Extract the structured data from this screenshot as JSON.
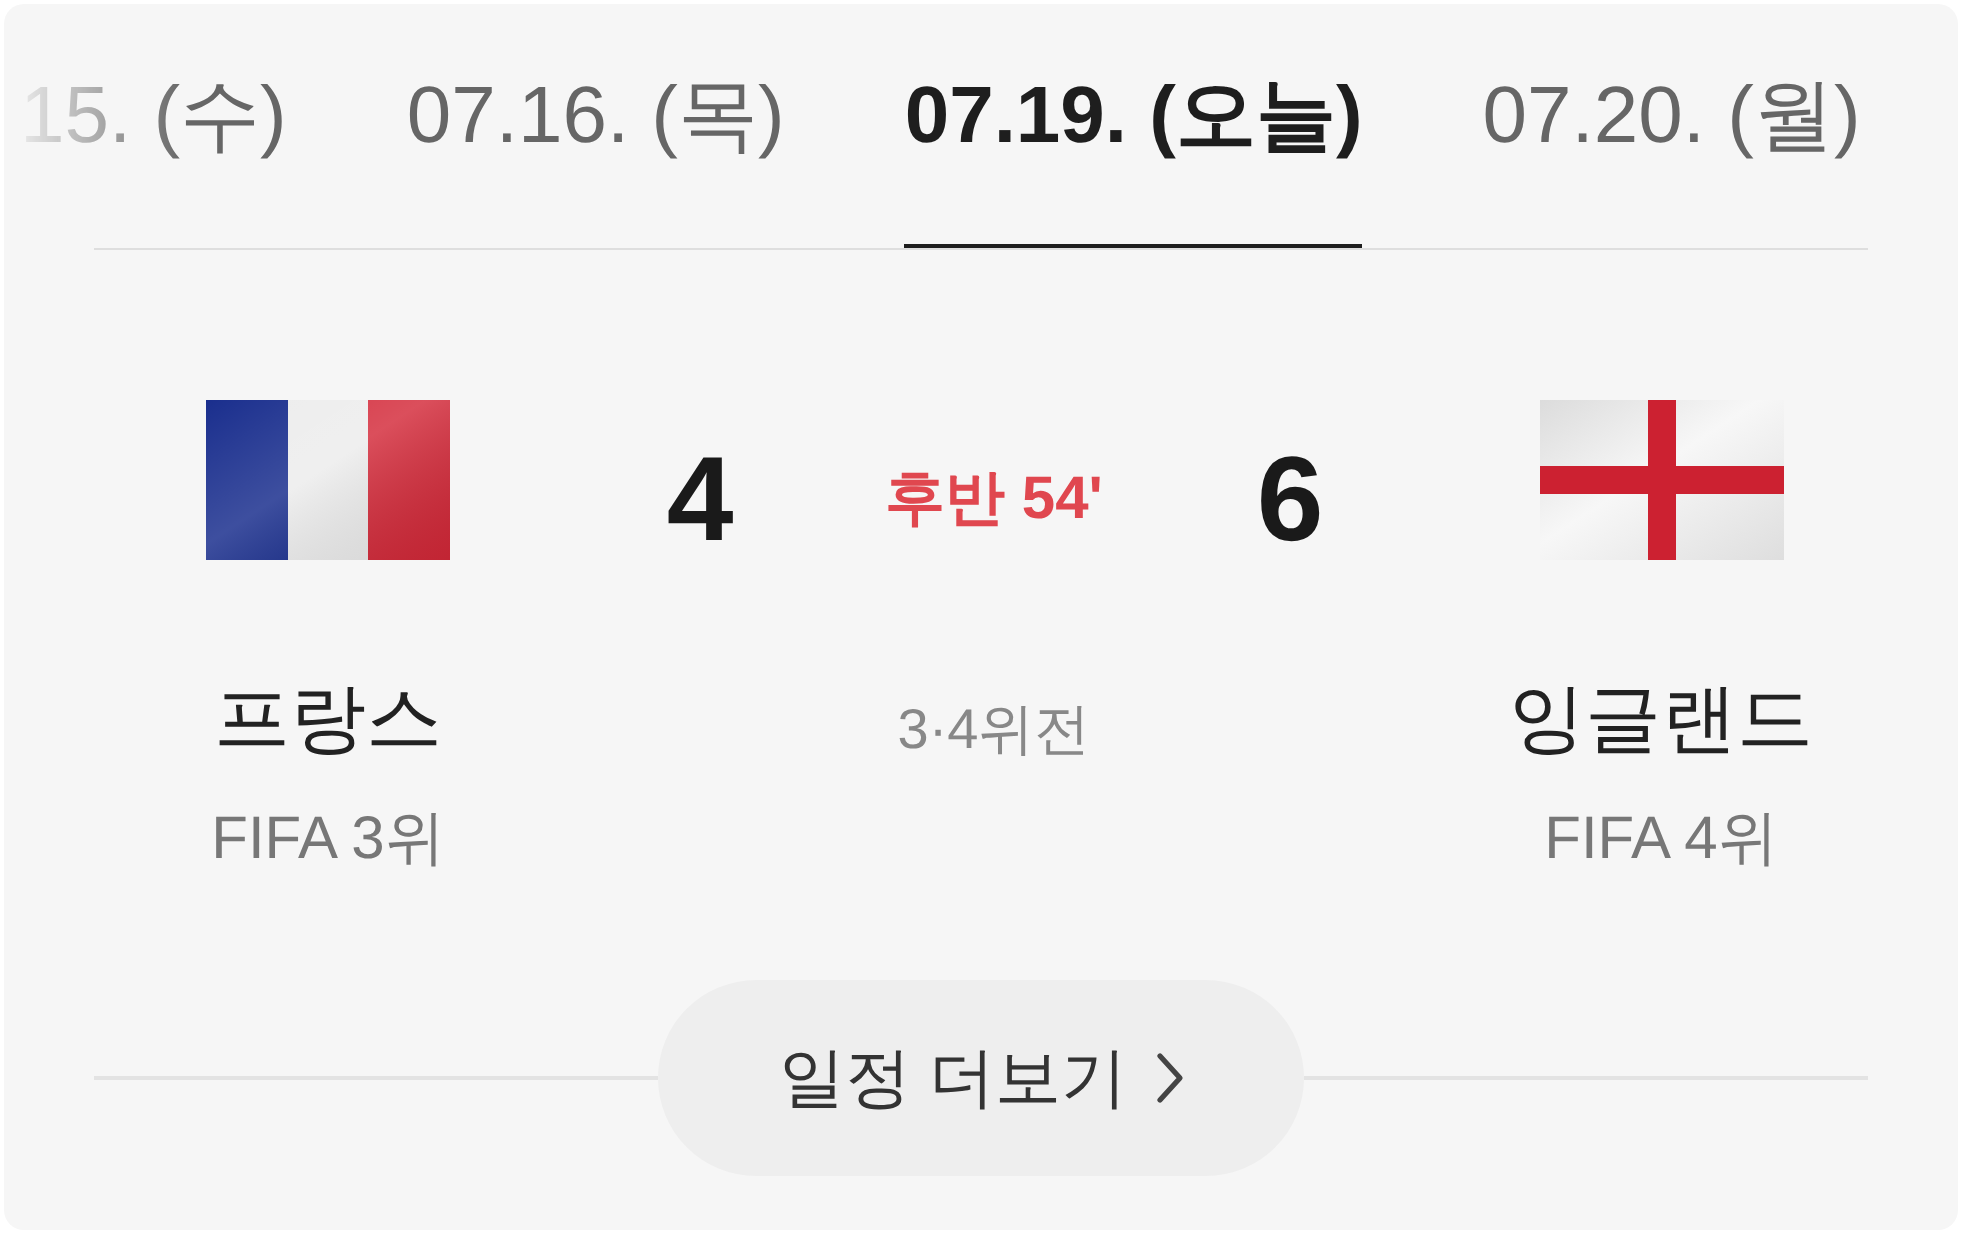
{
  "tabs": [
    {
      "label": "15. (수)",
      "selected": false
    },
    {
      "label": "07.16. (목)",
      "selected": false
    },
    {
      "label": "07.19. (오늘)",
      "selected": true
    },
    {
      "label": "07.20. (월)",
      "selected": false
    }
  ],
  "match": {
    "teams": [
      {
        "name": "프랑스",
        "rank": "FIFA 3위",
        "score": "4"
      },
      {
        "name": "잉글랜드",
        "rank": "FIFA 4위",
        "score": "6"
      }
    ],
    "status": "후반 54'",
    "round": "3·4위전"
  },
  "more_button": {
    "label": "일정 더보기"
  }
}
